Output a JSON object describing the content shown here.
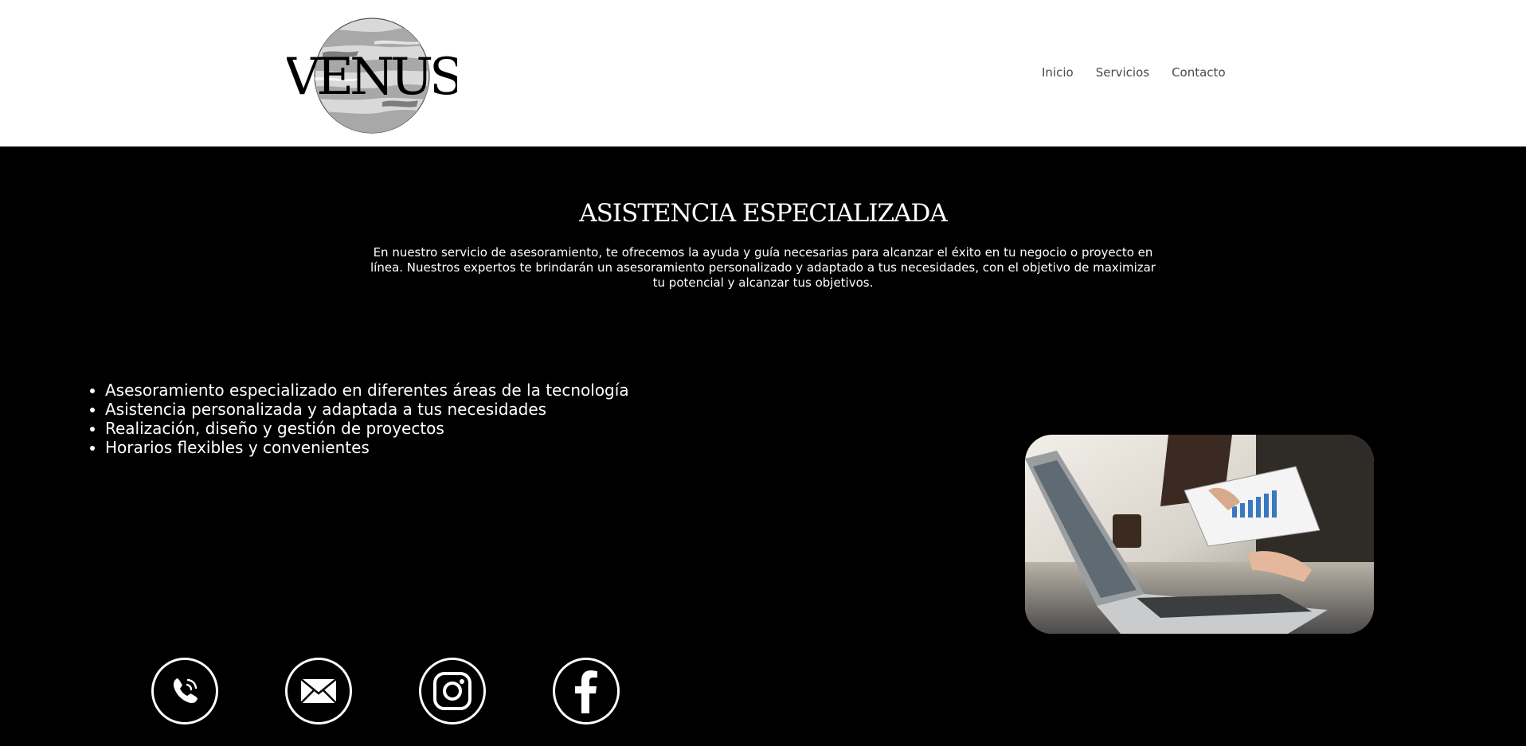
{
  "header": {
    "logo_text": "VENUS",
    "nav": [
      {
        "label": "Inicio"
      },
      {
        "label": "Servicios"
      },
      {
        "label": "Contacto"
      }
    ]
  },
  "main": {
    "title": "ASISTENCIA ESPECIALIZADA",
    "intro": "En nuestro servicio de asesoramiento, te ofrecemos la ayuda y guía necesarias para alcanzar el éxito en tu negocio o proyecto en línea. Nuestros expertos te brindarán un asesoramiento personalizado y adaptado a tus necesidades, con el objetivo de maximizar tu potencial y alcanzar tus objetivos.",
    "features": [
      "Asesoramiento especializado en diferentes áreas de la tecnología",
      "Asistencia personalizada y adaptada a tus necesidades",
      "Realización, diseño y gestión de proyectos",
      "Horarios flexibles y convenientes"
    ],
    "image": "laptop-business-photo"
  },
  "social": [
    {
      "icon": "phone-icon"
    },
    {
      "icon": "mail-icon"
    },
    {
      "icon": "instagram-icon"
    },
    {
      "icon": "facebook-icon"
    }
  ],
  "colors": {
    "header_bg": "#ffffff",
    "page_bg": "#000000",
    "text": "#ffffff",
    "nav_text": "#4a4a4a"
  }
}
